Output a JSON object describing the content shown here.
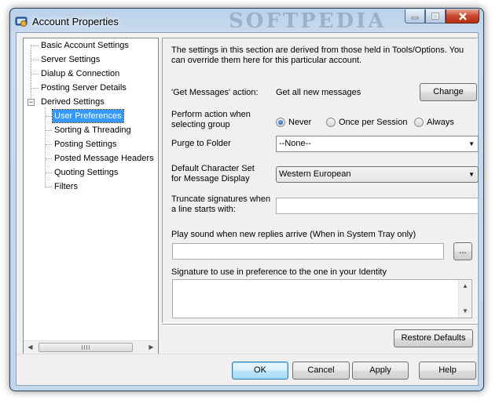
{
  "window": {
    "title": "Account Properties",
    "watermark": "SOFTPEDIA"
  },
  "tree": {
    "items": [
      {
        "label": "Basic Account Settings"
      },
      {
        "label": "Server Settings"
      },
      {
        "label": "Dialup & Connection"
      },
      {
        "label": "Posting Server Details"
      },
      {
        "label": "Derived Settings"
      },
      {
        "label": "User Preferences"
      },
      {
        "label": "Sorting & Threading"
      },
      {
        "label": "Posting Settings"
      },
      {
        "label": "Posted Message Headers"
      },
      {
        "label": "Quoting Settings"
      },
      {
        "label": "Filters"
      }
    ],
    "selected": "User Preferences"
  },
  "panel": {
    "description": "The settings in this section are derived from those held in Tools/Options.  You can override them here for this particular account.",
    "get_messages_label": "'Get Messages' action:",
    "get_messages_value": "Get all new messages",
    "change_button": "Change",
    "perform_action_label": "Perform action when selecting group",
    "radio_options": [
      "Never",
      "Once per Session",
      "Always"
    ],
    "radio_selected": "Never",
    "purge_label": "Purge to Folder",
    "purge_value": "--None--",
    "charset_label": "Default Character Set for Message Display",
    "charset_value": "Western European",
    "truncate_label": "Truncate signatures when a line starts with:",
    "truncate_value": "",
    "sound_label": "Play sound when new replies arrive (When in System Tray only)",
    "sound_value": "",
    "browse_button": "...",
    "signature_label": "Signature to use in preference to the one in your Identity",
    "signature_value": ""
  },
  "restore_button": "Restore Defaults",
  "footer": {
    "ok": "OK",
    "cancel": "Cancel",
    "apply": "Apply",
    "help": "Help"
  }
}
